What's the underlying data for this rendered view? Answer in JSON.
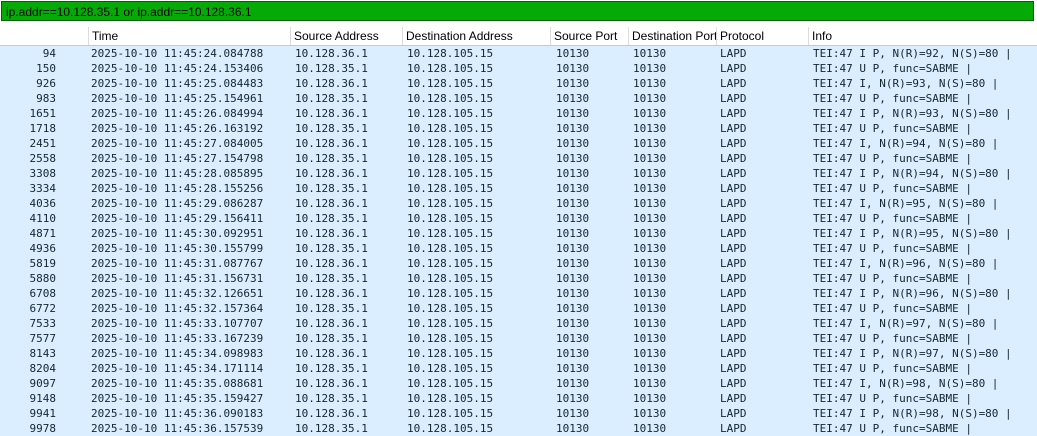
{
  "filter": {
    "text": "ip.addr==10.128.35.1 or ip.addr==10.128.36.1"
  },
  "columns": [
    "",
    "Time",
    "Source Address",
    "Destination Address",
    "Source Port",
    "Destination Port",
    "Protocol",
    "Info"
  ],
  "colors": {
    "filter_bg": "#06aa06",
    "row_bg": "#daeeff"
  },
  "rows": [
    [
      "94",
      "2025-10-10 11:45:24.084788",
      "10.128.36.1",
      "10.128.105.15",
      "10130",
      "10130",
      "LAPD",
      "TEI:47 I P, N(R)=92, N(S)=80 |"
    ],
    [
      "150",
      "2025-10-10 11:45:24.153406",
      "10.128.35.1",
      "10.128.105.15",
      "10130",
      "10130",
      "LAPD",
      "TEI:47 U P, func=SABME |"
    ],
    [
      "926",
      "2025-10-10 11:45:25.084483",
      "10.128.36.1",
      "10.128.105.15",
      "10130",
      "10130",
      "LAPD",
      "TEI:47 I, N(R)=93, N(S)=80 |"
    ],
    [
      "983",
      "2025-10-10 11:45:25.154961",
      "10.128.35.1",
      "10.128.105.15",
      "10130",
      "10130",
      "LAPD",
      "TEI:47 U P, func=SABME |"
    ],
    [
      "1651",
      "2025-10-10 11:45:26.084994",
      "10.128.36.1",
      "10.128.105.15",
      "10130",
      "10130",
      "LAPD",
      "TEI:47 I P, N(R)=93, N(S)=80 |"
    ],
    [
      "1718",
      "2025-10-10 11:45:26.163192",
      "10.128.35.1",
      "10.128.105.15",
      "10130",
      "10130",
      "LAPD",
      "TEI:47 U P, func=SABME |"
    ],
    [
      "2451",
      "2025-10-10 11:45:27.084005",
      "10.128.36.1",
      "10.128.105.15",
      "10130",
      "10130",
      "LAPD",
      "TEI:47 I, N(R)=94, N(S)=80 |"
    ],
    [
      "2558",
      "2025-10-10 11:45:27.154798",
      "10.128.35.1",
      "10.128.105.15",
      "10130",
      "10130",
      "LAPD",
      "TEI:47 U P, func=SABME |"
    ],
    [
      "3308",
      "2025-10-10 11:45:28.085895",
      "10.128.36.1",
      "10.128.105.15",
      "10130",
      "10130",
      "LAPD",
      "TEI:47 I P, N(R)=94, N(S)=80 |"
    ],
    [
      "3334",
      "2025-10-10 11:45:28.155256",
      "10.128.35.1",
      "10.128.105.15",
      "10130",
      "10130",
      "LAPD",
      "TEI:47 U P, func=SABME |"
    ],
    [
      "4036",
      "2025-10-10 11:45:29.086287",
      "10.128.36.1",
      "10.128.105.15",
      "10130",
      "10130",
      "LAPD",
      "TEI:47 I, N(R)=95, N(S)=80 |"
    ],
    [
      "4110",
      "2025-10-10 11:45:29.156411",
      "10.128.35.1",
      "10.128.105.15",
      "10130",
      "10130",
      "LAPD",
      "TEI:47 U P, func=SABME |"
    ],
    [
      "4871",
      "2025-10-10 11:45:30.092951",
      "10.128.36.1",
      "10.128.105.15",
      "10130",
      "10130",
      "LAPD",
      "TEI:47 I P, N(R)=95, N(S)=80 |"
    ],
    [
      "4936",
      "2025-10-10 11:45:30.155799",
      "10.128.35.1",
      "10.128.105.15",
      "10130",
      "10130",
      "LAPD",
      "TEI:47 U P, func=SABME |"
    ],
    [
      "5819",
      "2025-10-10 11:45:31.087767",
      "10.128.36.1",
      "10.128.105.15",
      "10130",
      "10130",
      "LAPD",
      "TEI:47 I, N(R)=96, N(S)=80 |"
    ],
    [
      "5880",
      "2025-10-10 11:45:31.156731",
      "10.128.35.1",
      "10.128.105.15",
      "10130",
      "10130",
      "LAPD",
      "TEI:47 U P, func=SABME |"
    ],
    [
      "6708",
      "2025-10-10 11:45:32.126651",
      "10.128.36.1",
      "10.128.105.15",
      "10130",
      "10130",
      "LAPD",
      "TEI:47 I P, N(R)=96, N(S)=80 |"
    ],
    [
      "6772",
      "2025-10-10 11:45:32.157364",
      "10.128.35.1",
      "10.128.105.15",
      "10130",
      "10130",
      "LAPD",
      "TEI:47 U P, func=SABME |"
    ],
    [
      "7533",
      "2025-10-10 11:45:33.107707",
      "10.128.36.1",
      "10.128.105.15",
      "10130",
      "10130",
      "LAPD",
      "TEI:47 I, N(R)=97, N(S)=80 |"
    ],
    [
      "7577",
      "2025-10-10 11:45:33.167239",
      "10.128.35.1",
      "10.128.105.15",
      "10130",
      "10130",
      "LAPD",
      "TEI:47 U P, func=SABME |"
    ],
    [
      "8143",
      "2025-10-10 11:45:34.098983",
      "10.128.36.1",
      "10.128.105.15",
      "10130",
      "10130",
      "LAPD",
      "TEI:47 I P, N(R)=97, N(S)=80 |"
    ],
    [
      "8204",
      "2025-10-10 11:45:34.171114",
      "10.128.35.1",
      "10.128.105.15",
      "10130",
      "10130",
      "LAPD",
      "TEI:47 U P, func=SABME |"
    ],
    [
      "9097",
      "2025-10-10 11:45:35.088681",
      "10.128.36.1",
      "10.128.105.15",
      "10130",
      "10130",
      "LAPD",
      "TEI:47 I, N(R)=98, N(S)=80 |"
    ],
    [
      "9148",
      "2025-10-10 11:45:35.159427",
      "10.128.35.1",
      "10.128.105.15",
      "10130",
      "10130",
      "LAPD",
      "TEI:47 U P, func=SABME |"
    ],
    [
      "9941",
      "2025-10-10 11:45:36.090183",
      "10.128.36.1",
      "10.128.105.15",
      "10130",
      "10130",
      "LAPD",
      "TEI:47 I P, N(R)=98, N(S)=80 |"
    ],
    [
      "9978",
      "2025-10-10 11:45:36.157539",
      "10.128.35.1",
      "10.128.105.15",
      "10130",
      "10130",
      "LAPD",
      "TEI:47 U P, func=SABME |"
    ]
  ]
}
